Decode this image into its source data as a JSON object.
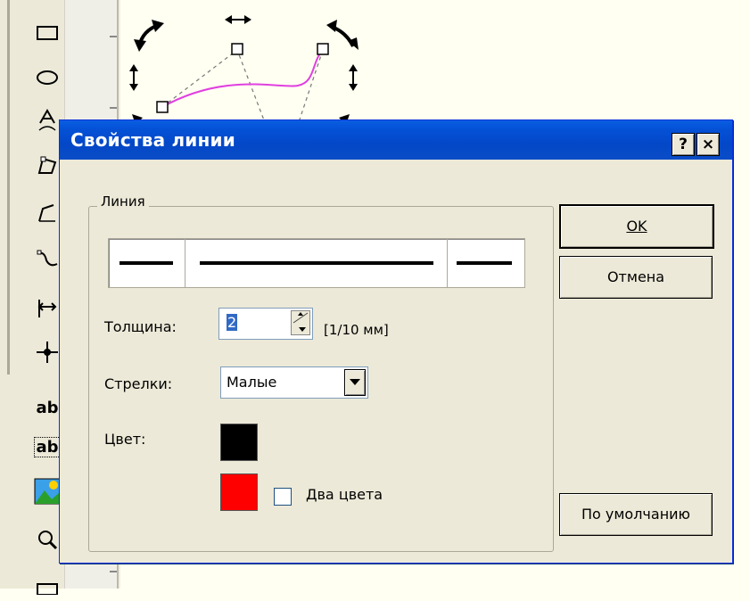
{
  "toolbar": {
    "tools": [
      {
        "icon": "rectangle-icon"
      },
      {
        "icon": "ellipse-icon"
      },
      {
        "icon": "text-path-icon"
      },
      {
        "icon": "node-edit-icon"
      },
      {
        "icon": "polyline-icon"
      },
      {
        "icon": "curve-icon"
      },
      {
        "icon": "dimension-icon"
      },
      {
        "icon": "point-icon"
      },
      {
        "icon": "text-tool-icon",
        "label": "ab"
      },
      {
        "icon": "text-frame-icon",
        "label": "ab"
      },
      {
        "icon": "image-icon"
      },
      {
        "icon": "zoom-icon"
      }
    ]
  },
  "dialog": {
    "title": "Свойства линии",
    "help_label": "?",
    "close_label": "×",
    "group_label": "Линия",
    "thickness_label": "Толщина:",
    "thickness_value": "2",
    "thickness_unit": "[1/10 мм]",
    "arrows_label": "Стрелки:",
    "arrows_value": "Малые",
    "color_label": "Цвет:",
    "color_primary": "#000000",
    "color_secondary": "#ff0000",
    "two_colors_label": "Два цвета",
    "two_colors_checked": false,
    "ok_label": "OK",
    "cancel_label": "Отмена",
    "default_label": "По умолчанию"
  },
  "colors": {
    "titlebar": "#0347c7",
    "dialog_bg": "#ece9d8",
    "curve": "#e040e0",
    "canvas_bg": "#fffff2"
  }
}
